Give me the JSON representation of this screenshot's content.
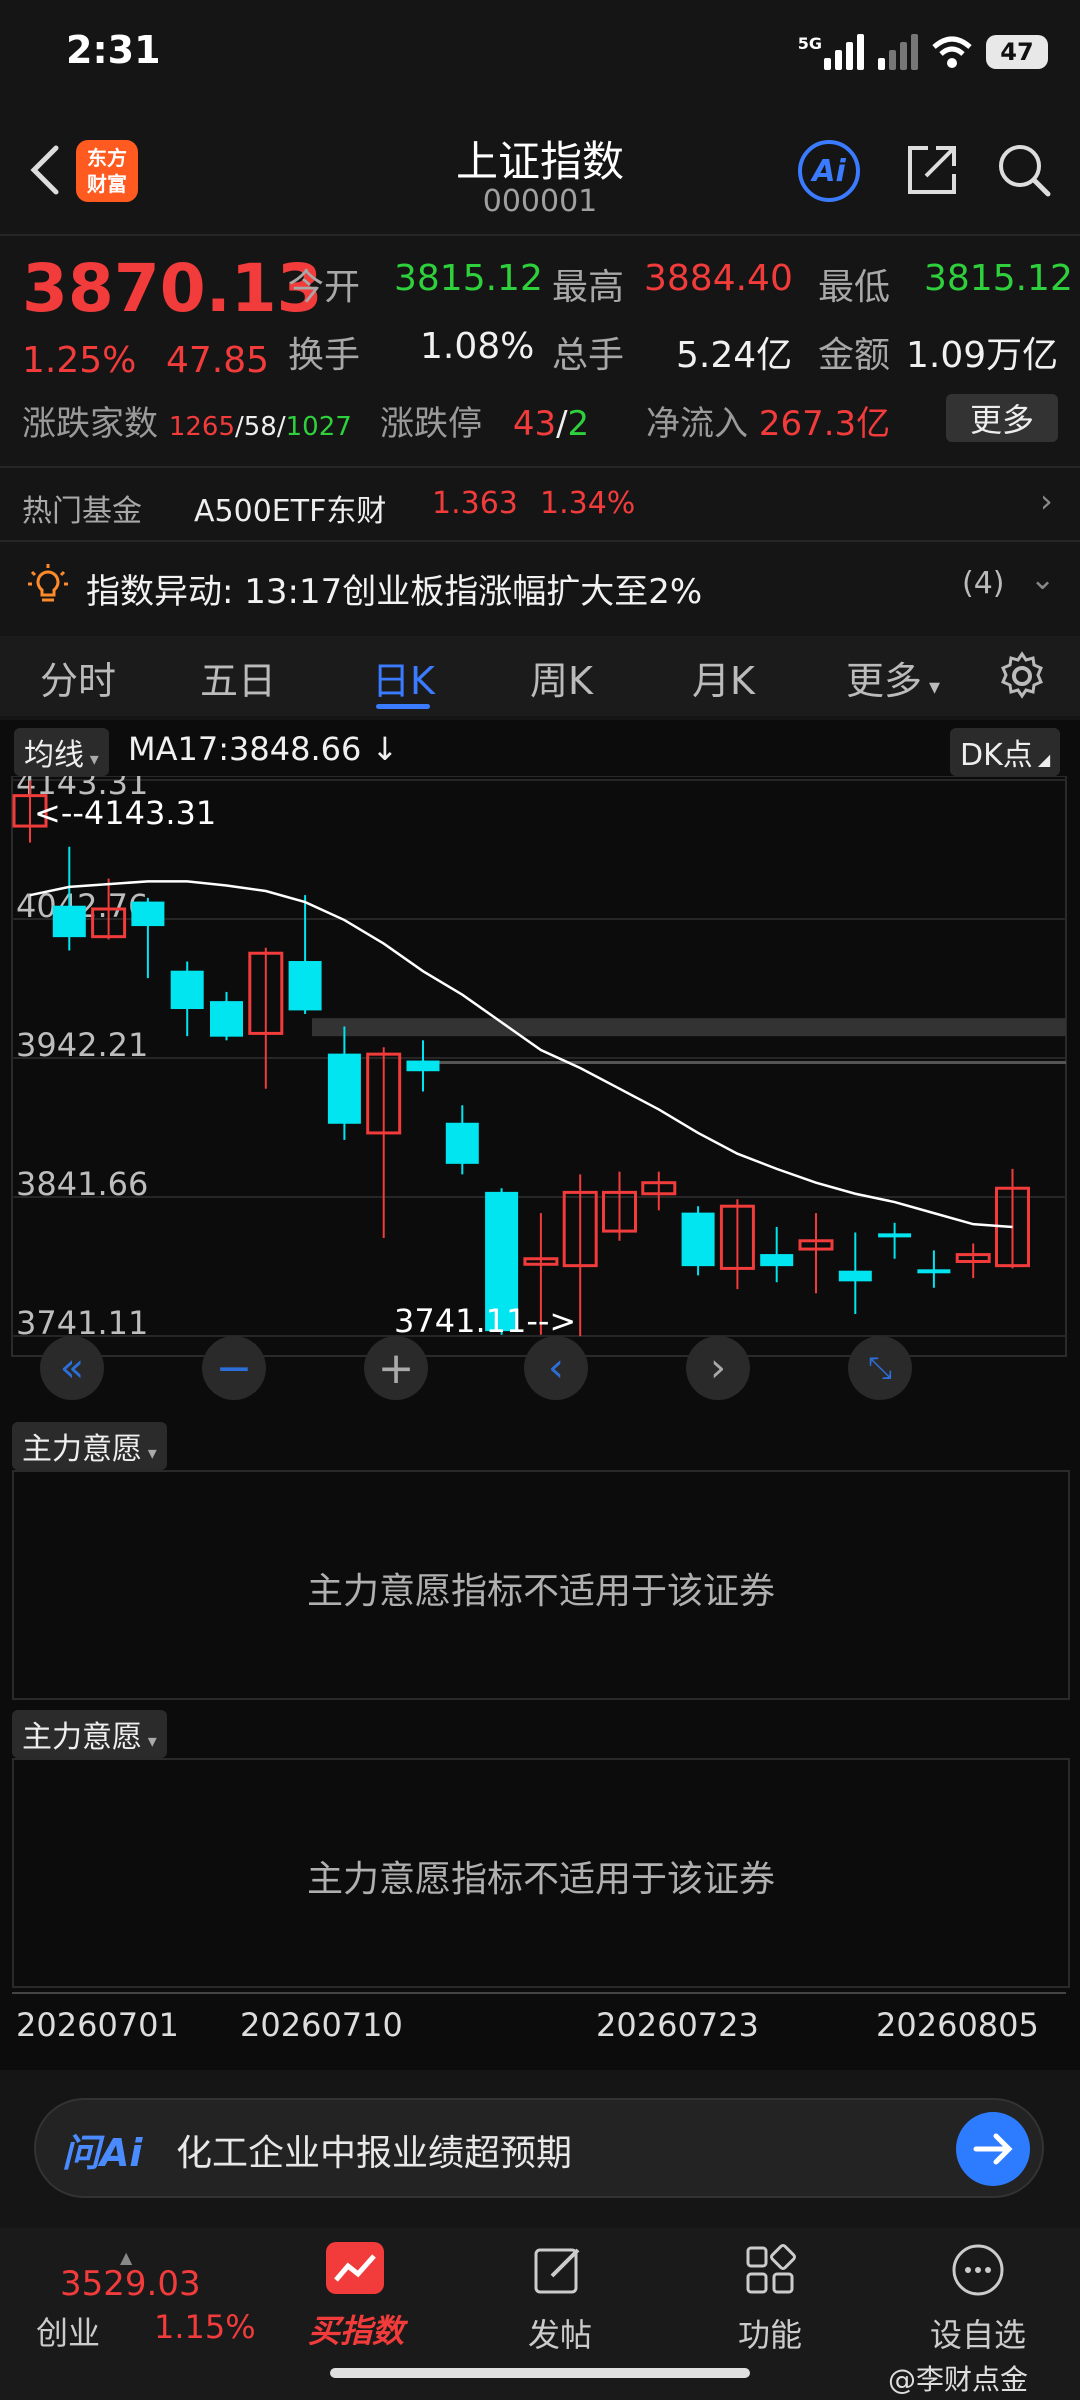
{
  "status": {
    "time": "2:31",
    "network": "5G",
    "battery": "47"
  },
  "header": {
    "logo_line1": "东方",
    "logo_line2": "财富",
    "title": "上证指数",
    "code": "000001",
    "ai_label": "Ai"
  },
  "quote": {
    "price": "3870.13",
    "change_pct": "1.25%",
    "change": "47.85",
    "open_label": "今开",
    "open": "3815.12",
    "high_label": "最高",
    "high": "3884.40",
    "low_label": "最低",
    "low": "3815.12",
    "turnover_label": "换手",
    "turnover": "1.08%",
    "volume_label": "总手",
    "volume": "5.24亿",
    "amount_label": "金额",
    "amount": "1.09万亿",
    "breadth_label": "涨跌家数",
    "breadth_up": "1265",
    "breadth_flat": "58",
    "breadth_down": "1027",
    "limit_label": "涨跌停",
    "limit_up": "43",
    "limit_down": "2",
    "inflow_label": "净流入",
    "inflow": "267.3亿",
    "more_label": "更多"
  },
  "hot_fund": {
    "label": "热门基金",
    "name": "A500ETF东财",
    "price": "1.363",
    "pct": "1.34%"
  },
  "alert": {
    "text": "指数异动: 13:17创业板指涨幅扩大至2%",
    "count": "(4)"
  },
  "tabs": [
    {
      "label": "分时"
    },
    {
      "label": "五日"
    },
    {
      "label": "日K"
    },
    {
      "label": "周K"
    },
    {
      "label": "月K"
    },
    {
      "label": "更多"
    }
  ],
  "chart_toolbar": {
    "indicator": "均线",
    "ma": "MA17:3848.66 ↓",
    "dk": "DK点"
  },
  "chart_data": {
    "type": "candlestick",
    "y_ticks": [
      "4143.31",
      "4042.76",
      "3942.21",
      "3841.66",
      "3741.11"
    ],
    "ylim": [
      3741.11,
      4143.31
    ],
    "x_ticks": [
      "20260701",
      "20260710",
      "20260723",
      "20260805"
    ],
    "max_label": "<--4143.31",
    "min_label": "3741.11-->",
    "candles": [
      {
        "o": 4110,
        "c": 4132,
        "h": 4143,
        "l": 4098
      },
      {
        "o": 4052,
        "c": 4030,
        "h": 4095,
        "l": 4020
      },
      {
        "o": 4030,
        "c": 4050,
        "h": 4072,
        "l": 4028
      },
      {
        "o": 4055,
        "c": 4038,
        "h": 4058,
        "l": 4000
      },
      {
        "o": 4005,
        "c": 3978,
        "h": 4012,
        "l": 3958
      },
      {
        "o": 3983,
        "c": 3958,
        "h": 3990,
        "l": 3955
      },
      {
        "o": 3960,
        "c": 4018,
        "h": 4022,
        "l": 3920
      },
      {
        "o": 4012,
        "c": 3977,
        "h": 4060,
        "l": 3974
      },
      {
        "o": 3945,
        "c": 3895,
        "h": 3965,
        "l": 3883
      },
      {
        "o": 3888,
        "c": 3945,
        "h": 3950,
        "l": 3812
      },
      {
        "o": 3940,
        "c": 3933,
        "h": 3955,
        "l": 3918
      },
      {
        "o": 3895,
        "c": 3866,
        "h": 3908,
        "l": 3858
      },
      {
        "o": 3845,
        "c": 3745,
        "h": 3848,
        "l": 3742
      },
      {
        "o": 3793,
        "c": 3797,
        "h": 3830,
        "l": 3742
      },
      {
        "o": 3792,
        "c": 3845,
        "h": 3858,
        "l": 3741
      },
      {
        "o": 3817,
        "c": 3845,
        "h": 3860,
        "l": 3810
      },
      {
        "o": 3844,
        "c": 3852,
        "h": 3860,
        "l": 3832
      },
      {
        "o": 3830,
        "c": 3792,
        "h": 3835,
        "l": 3785
      },
      {
        "o": 3790,
        "c": 3835,
        "h": 3840,
        "l": 3775
      },
      {
        "o": 3800,
        "c": 3792,
        "h": 3820,
        "l": 3780
      },
      {
        "o": 3804,
        "c": 3810,
        "h": 3830,
        "l": 3772
      },
      {
        "o": 3788,
        "c": 3781,
        "h": 3816,
        "l": 3757
      },
      {
        "o": 3815,
        "c": 3815,
        "h": 3823,
        "l": 3797
      },
      {
        "o": 3789,
        "c": 3789,
        "h": 3803,
        "l": 3776
      },
      {
        "o": 3795,
        "c": 3800,
        "h": 3808,
        "l": 3783
      },
      {
        "o": 3792,
        "c": 3848,
        "h": 3862,
        "l": 3790
      }
    ],
    "ma17": [
      4060,
      4066,
      4068,
      4070,
      4070,
      4067,
      4063,
      4055,
      4042,
      4025,
      4005,
      3988,
      3968,
      3948,
      3935,
      3920,
      3905,
      3888,
      3873,
      3862,
      3852,
      3844,
      3838,
      3830,
      3822,
      3820
    ]
  },
  "panels": [
    {
      "label": "主力意愿",
      "message": "主力意愿指标不适用于该证券"
    },
    {
      "label": "主力意愿",
      "message": "主力意愿指标不适用于该证券"
    }
  ],
  "ask": {
    "logo": "问Ai",
    "text": "化工企业中报业绩超预期"
  },
  "bottom_nav": {
    "cyb_value": "3529.03",
    "cyb_label": "创业",
    "cyb_pct": "1.15%",
    "items": [
      {
        "label": "买指数"
      },
      {
        "label": "发帖"
      },
      {
        "label": "功能"
      },
      {
        "label": "设自选"
      }
    ]
  },
  "watermark": "@李财点金",
  "colors": {
    "up": "#f23b3b",
    "down": "#00e5f0",
    "accent": "#3b7bff",
    "ma": "#ffffff"
  }
}
